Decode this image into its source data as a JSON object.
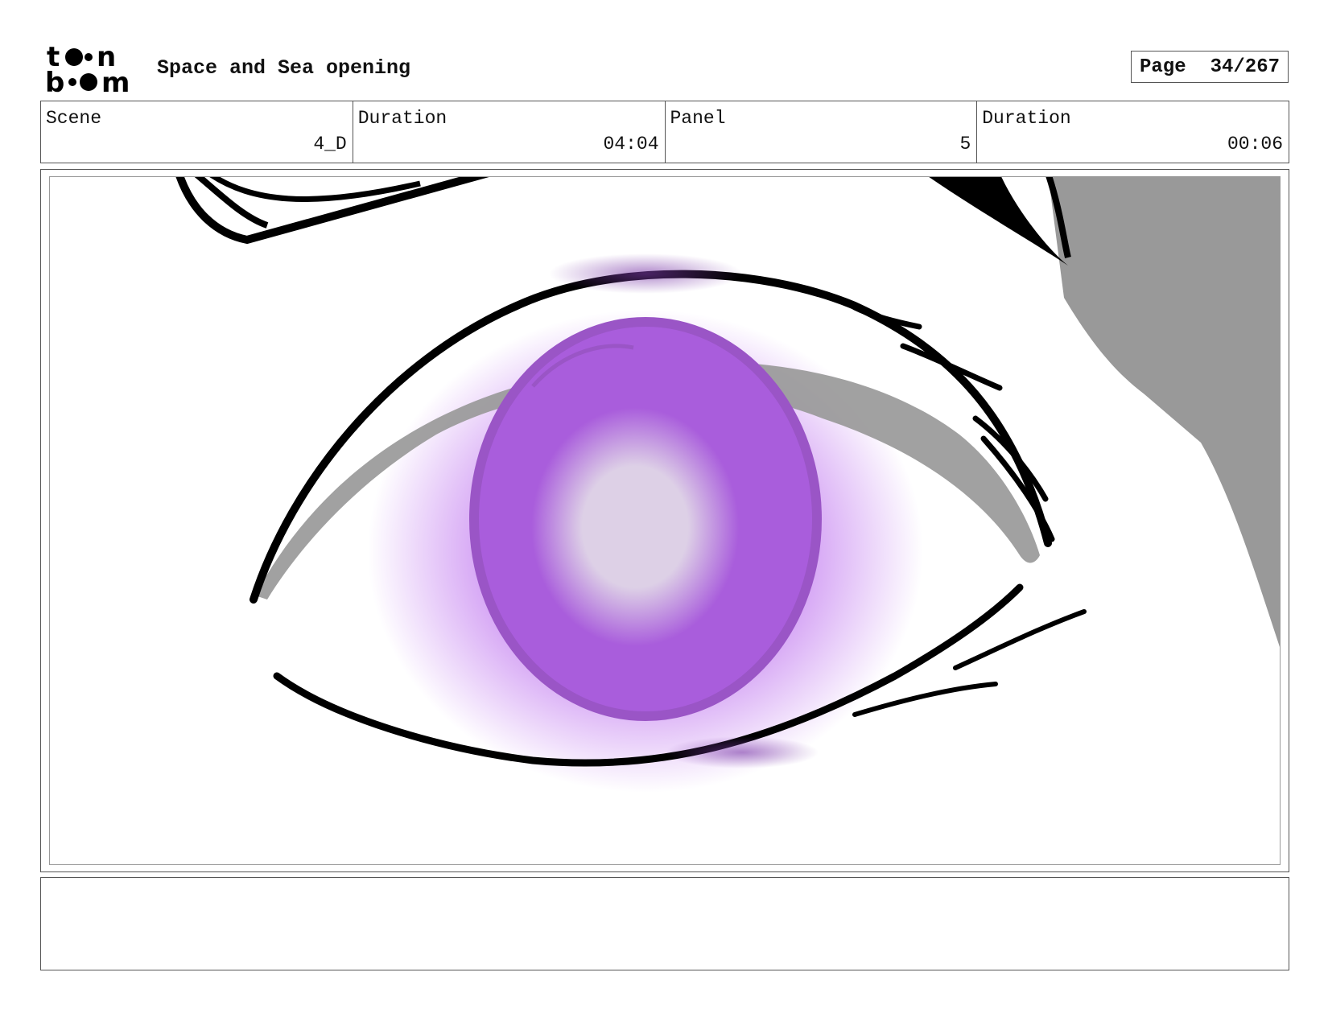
{
  "header": {
    "logo_alt": "toon boom",
    "title": "Space and Sea opening",
    "page_label": "Page",
    "page_value": "34/267"
  },
  "info": {
    "scene_label": "Scene",
    "scene_value": "4_D",
    "scene_duration_label": "Duration",
    "scene_duration_value": "04:04",
    "panel_label": "Panel",
    "panel_value": "5",
    "panel_duration_label": "Duration",
    "panel_duration_value": "00:06"
  },
  "panel": {
    "drawing": "eye-closeup-icon",
    "iris_color": "#a95ddc",
    "glow_color": "#cf97f3",
    "pupil_color": "#ddd0e6",
    "lid_shadow_color": "#999999",
    "line_color": "#000000"
  },
  "notes": {
    "text": ""
  }
}
